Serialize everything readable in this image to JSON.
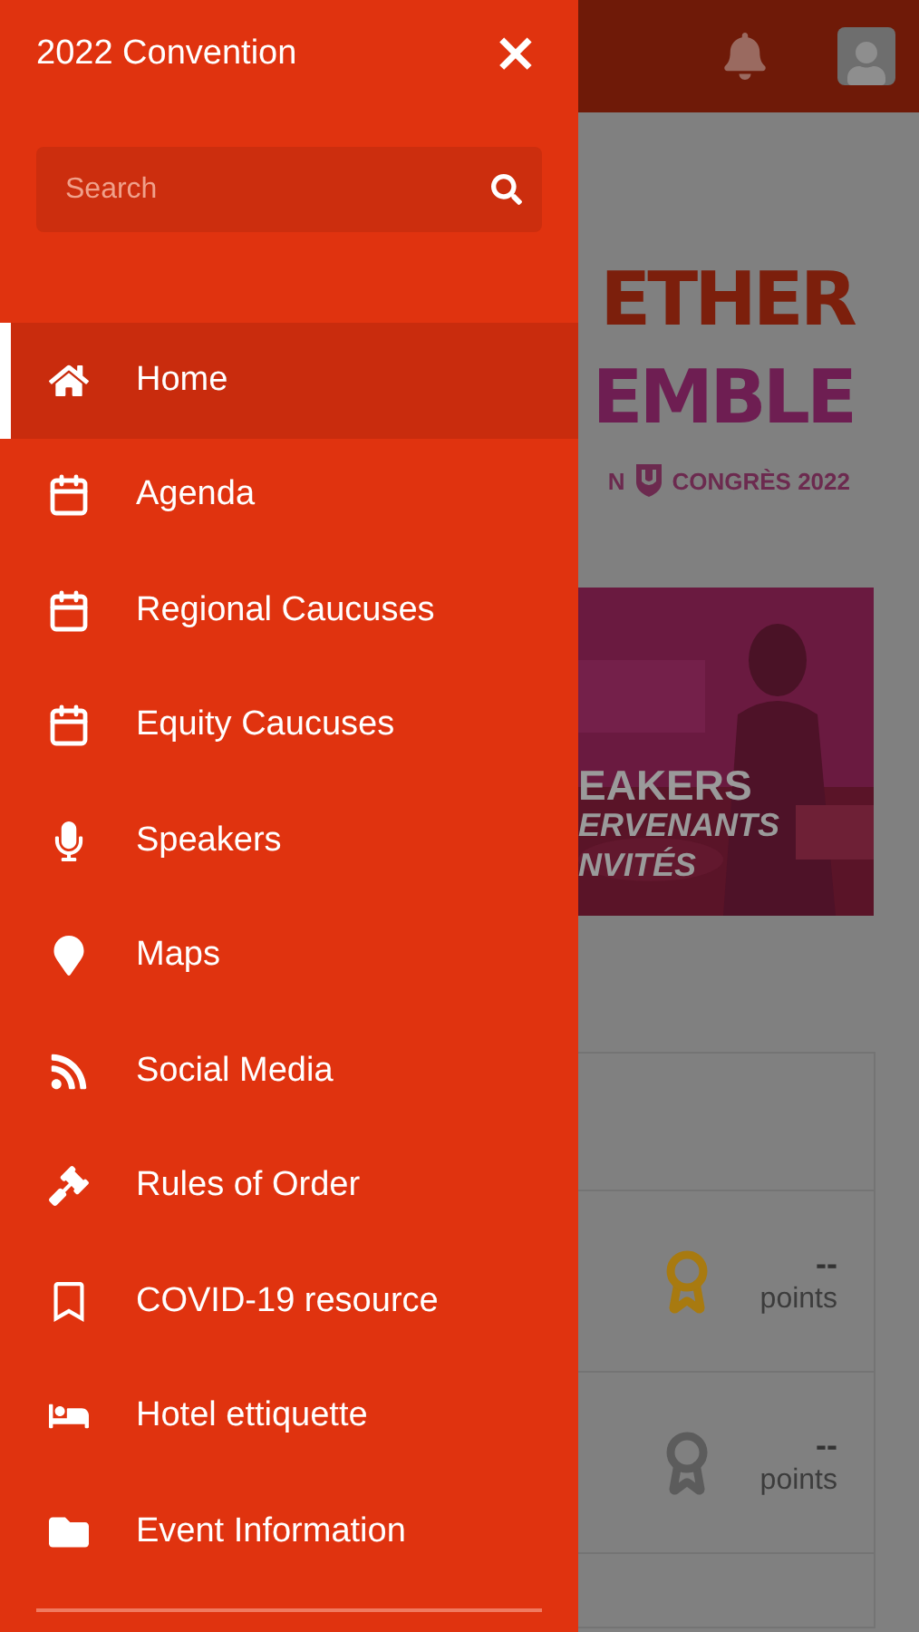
{
  "drawer": {
    "title": "2022 Convention",
    "close": "×",
    "search": {
      "placeholder": "Search"
    },
    "items": [
      {
        "label": "Home",
        "kind": "home",
        "selected": true
      },
      {
        "label": "Agenda",
        "kind": "calendar",
        "selected": false
      },
      {
        "label": "Regional Caucuses",
        "kind": "calendar",
        "selected": false
      },
      {
        "label": "Equity Caucuses",
        "kind": "calendar",
        "selected": false
      },
      {
        "label": "Speakers",
        "kind": "microphone",
        "selected": false
      },
      {
        "label": "Maps",
        "kind": "marker",
        "selected": false
      },
      {
        "label": "Social Media",
        "kind": "rss",
        "selected": false
      },
      {
        "label": "Rules of Order",
        "kind": "gavel",
        "selected": false
      },
      {
        "label": "COVID-19 resource",
        "kind": "bookmark",
        "selected": false
      },
      {
        "label": "Hotel ettiquette",
        "kind": "bed",
        "selected": false
      },
      {
        "label": "Event Information",
        "kind": "folder",
        "selected": false
      }
    ]
  },
  "page": {
    "banner": {
      "line_1": "ETHER",
      "line_2": "EMBLE",
      "line_3_start": "N",
      "line_3_end": "CONGRÈS 2022"
    },
    "speakers_card": {
      "kind": "picture",
      "lines": [
        "EAKERS",
        "ERVENANTS",
        "NVITÉS"
      ]
    },
    "points": [
      {
        "value": "--",
        "unit": "points",
        "color": "#a87a10"
      },
      {
        "value": "--",
        "unit": "points",
        "color": "#5c5c5c"
      }
    ]
  }
}
